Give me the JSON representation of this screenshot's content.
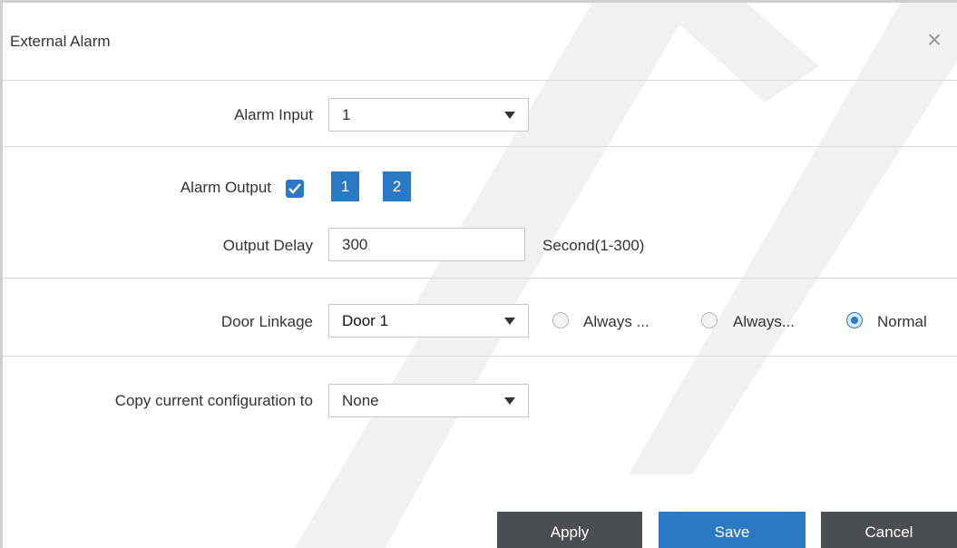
{
  "dialog": {
    "title": "External Alarm",
    "close_label": "×"
  },
  "alarm_input": {
    "label": "Alarm Input",
    "value": "1"
  },
  "alarm_output": {
    "label": "Alarm Output",
    "checked": true,
    "channels": [
      "1",
      "2"
    ]
  },
  "output_delay": {
    "label": "Output Delay",
    "value": "300",
    "hint": "Second(1-300)"
  },
  "door_linkage": {
    "label": "Door Linkage",
    "value": "Door 1",
    "options": [
      {
        "label": "Always ...",
        "selected": false
      },
      {
        "label": "Always...",
        "selected": false
      },
      {
        "label": "Normal",
        "selected": true
      }
    ]
  },
  "copy_config": {
    "label": "Copy current configuration to",
    "value": "None"
  },
  "buttons": {
    "apply": "Apply",
    "save": "Save",
    "cancel": "Cancel"
  },
  "colors": {
    "accent": "#2b78c5",
    "apply_bg": "#4a4d52",
    "cancel_bg": "#4a4d52"
  }
}
